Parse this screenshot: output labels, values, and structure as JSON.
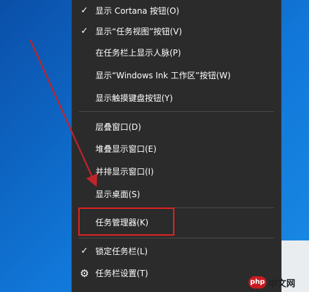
{
  "menu": {
    "items": [
      {
        "label": "显示 Cortana 按钮(O)",
        "checked": true
      },
      {
        "label": "显示“任务视图”按钮(V)",
        "checked": true
      },
      {
        "label": "在任务栏上显示人脉(P)",
        "checked": false
      },
      {
        "label": "显示“Windows Ink 工作区”按钮(W)",
        "checked": false
      },
      {
        "label": "显示触摸键盘按钮(Y)",
        "checked": false
      },
      {
        "label": "层叠窗口(D)",
        "checked": false
      },
      {
        "label": "堆叠显示窗口(E)",
        "checked": false
      },
      {
        "label": "并排显示窗口(I)",
        "checked": false
      },
      {
        "label": "显示桌面(S)",
        "checked": false
      },
      {
        "label": "任务管理器(K)",
        "checked": false
      },
      {
        "label": "锁定任务栏(L)",
        "checked": true
      },
      {
        "label": "任务栏设置(T)",
        "icon": "gear-icon"
      }
    ],
    "check_glyph": "✓",
    "gear_glyph": "⚙"
  },
  "watermark": {
    "logo_text": "php",
    "text": "中文网"
  },
  "colors": {
    "menu_bg": "#2b2b2b",
    "highlight_border": "#e32222",
    "arrow": "#c0242a",
    "desktop": "#1177d8"
  }
}
